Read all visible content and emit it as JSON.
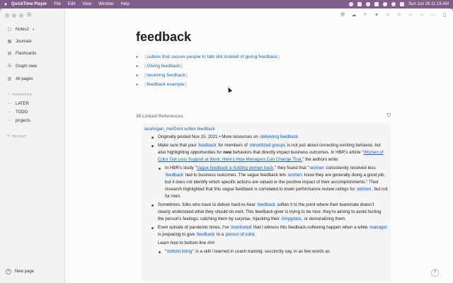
{
  "menubar": {
    "app_name": "QuickTime Player",
    "items": [
      "File",
      "Edit",
      "View",
      "Window",
      "Help"
    ],
    "clock": "Sun Jun 26  11:18 AM"
  },
  "sidebar": {
    "graph_name": "Notes2",
    "nav": [
      {
        "icon": "calendar-icon",
        "label": "Journals"
      },
      {
        "icon": "flashcards-icon",
        "label": "Flashcards"
      },
      {
        "icon": "graph-icon",
        "label": "Graph view"
      },
      {
        "icon": "pages-icon",
        "label": "All pages"
      }
    ],
    "favorites_label": "FAVORITES",
    "favorites": [
      "LATER",
      "TODO",
      "projects"
    ],
    "recent_label": "RECENT",
    "new_page_label": "New page"
  },
  "page": {
    "title": "feedback",
    "links": [
      "culture that causes people to talk shit instead of giving feedback",
      "Giving feedback",
      "receiving feedback",
      "feedback example"
    ],
    "linked_refs_label": "39 Linked References"
  },
  "reference": {
    "source": "larahogan_me/Dont soften feedback",
    "block1": {
      "prefix": "Originally posted Nov 15, 2021 • More resources on ",
      "tag": "delivering feedback"
    },
    "block2": {
      "t1": "Make sure that your ",
      "tag1": "feedback",
      "t2": " for members of ",
      "tag2": "minoritized groups",
      "t3": " is not just about correcting existing behavior, but also highlighting opportunities for ",
      "bold": "new",
      "t4": " behaviors that directly impact business outcomes. In HBR's article \"",
      "link": "Women of Color Get Less Support at Work. Here's How Managers Can Change That.",
      "t5": "\" the authors write:"
    },
    "block3": {
      "t1": "In HBR's study \"",
      "link": "Vague feedback is holding women back",
      "t2": ",\" they found that \"",
      "tag1": "women",
      "t3": " consistently received less ",
      "tag2": "feedback",
      "t4": " tied to business outcomes. The vague feedback lets ",
      "tag3": "women",
      "t5": " know they are generally doing a good job, but it does not identify which specific actions are valued or the positive impact of their accomplishments.\" Their research highlighted that this vague feedback is correlated to lower performance review ratings for ",
      "tag4": "women",
      "t6": ", but not for men."
    },
    "block4": {
      "t1": "Sometimes, folks who have to deliver hard-to-hear ",
      "tag1": "feedback",
      "t2": " soften it to the point where their teammate doesn't clearly understand what they should do next. This feedback-giver is trying to be nice: they're aiming to avoid hurting the person's feelings, catching them by surprise, hijacking their ",
      "tag2": "Amygdala",
      "t3": ", or demoralizing them."
    },
    "block5": {
      "t1": "Even outside of pandemic times, I've ",
      "tag1": "mentioned",
      "t2": " that I witness this feedback-softening happen when a white ",
      "tag2": "manager",
      "t3": " is preparing to give ",
      "tag3": "feedback",
      "t4": " to a ",
      "tag4": "person of color",
      "t5": "."
    },
    "heading": "Learn how to bottom-line ###",
    "block6": {
      "t1": "\"",
      "tag1": "bottom lining",
      "t2": "\" is a skill I learned in coach training: succinctly say, in as few words as"
    }
  },
  "help_label": "?"
}
